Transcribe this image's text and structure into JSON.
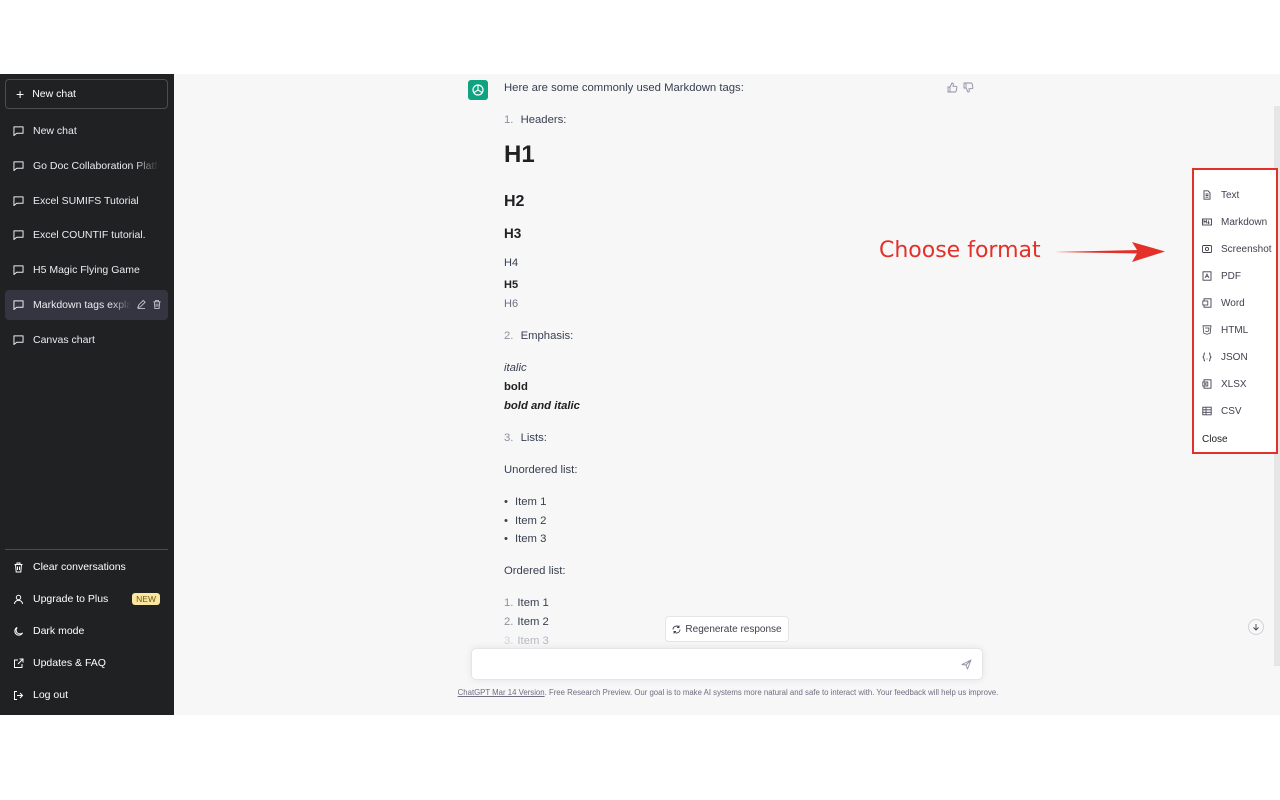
{
  "sidebar": {
    "new_chat_label": "New chat",
    "chats": [
      {
        "label": "New chat"
      },
      {
        "label": "Go Doc Collaboration Platfo"
      },
      {
        "label": "Excel SUMIFS Tutorial"
      },
      {
        "label": "Excel COUNTIF tutorial."
      },
      {
        "label": "H5 Magic Flying Game"
      },
      {
        "label": "Markdown tags expla"
      },
      {
        "label": "Canvas chart"
      }
    ],
    "bottom": {
      "clear": "Clear conversations",
      "upgrade": "Upgrade to Plus",
      "upgrade_badge": "NEW",
      "dark_mode": "Dark mode",
      "updates": "Updates & FAQ",
      "logout": "Log out"
    }
  },
  "message": {
    "intro": "Here are some commonly used Markdown tags:",
    "s1_num": "1.",
    "s1_title": "Headers:",
    "h1": "H1",
    "h2": "H2",
    "h3": "H3",
    "h4": "H4",
    "h5": "H5",
    "h6": "H6",
    "s2_num": "2.",
    "s2_title": "Emphasis:",
    "italic": "italic",
    "bold": "bold",
    "bold_italic": "bold and italic",
    "s3_num": "3.",
    "s3_title": "Lists:",
    "unordered_label": "Unordered list:",
    "unordered": [
      "Item 1",
      "Item 2",
      "Item 3"
    ],
    "ordered_label": "Ordered list:",
    "ordered_nums": [
      "1.",
      "2.",
      "3."
    ],
    "ordered": [
      "Item 1",
      "Item 2",
      "Item 3"
    ]
  },
  "regenerate_label": "Regenerate response",
  "footer": {
    "version_link": "ChatGPT Mar 14 Version",
    "note": ". Free Research Preview. Our goal is to make AI systems more natural and safe to interact with. Your feedback will help us improve."
  },
  "export_menu": {
    "items": [
      {
        "label": "Text",
        "icon": "text-doc-icon"
      },
      {
        "label": "Markdown",
        "icon": "markdown-icon"
      },
      {
        "label": "Screenshot",
        "icon": "screenshot-icon"
      },
      {
        "label": "PDF",
        "icon": "pdf-icon"
      },
      {
        "label": "Word",
        "icon": "word-icon"
      },
      {
        "label": "HTML",
        "icon": "html-icon"
      },
      {
        "label": "JSON",
        "icon": "json-icon"
      },
      {
        "label": "XLSX",
        "icon": "xlsx-icon"
      },
      {
        "label": "CSV",
        "icon": "csv-icon"
      }
    ],
    "close_label": "Close"
  },
  "annotation": "Choose format",
  "colors": {
    "sidebar_bg": "#202123",
    "main_bg": "#f7f7f8",
    "accent_green": "#10a37f",
    "annotation_red": "#e3312a",
    "badge_yellow": "#fae69e"
  }
}
